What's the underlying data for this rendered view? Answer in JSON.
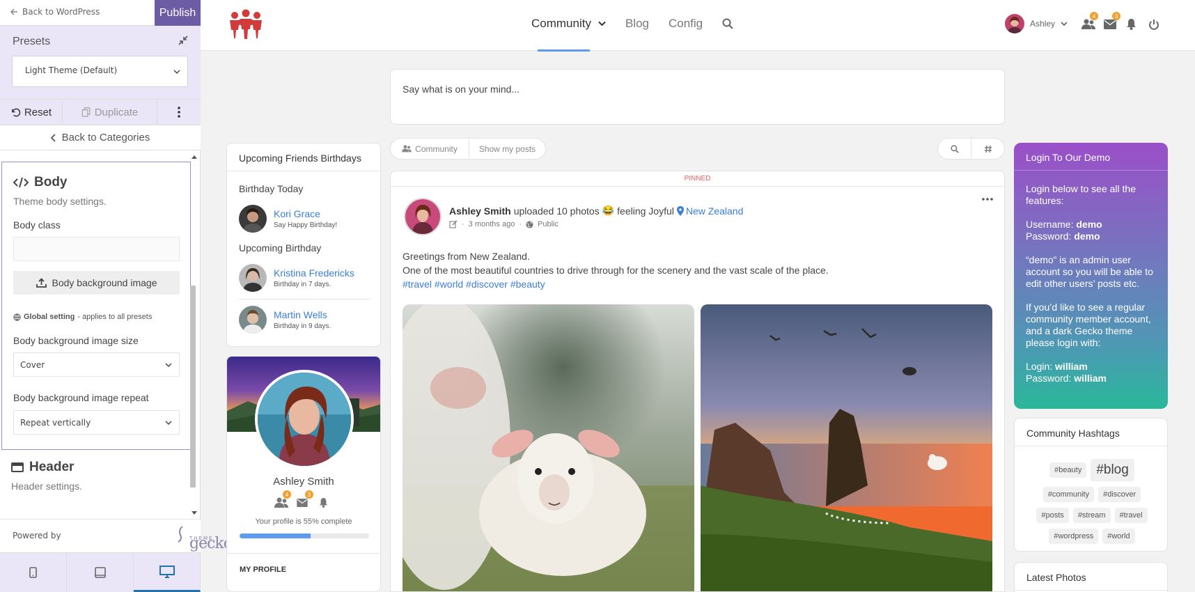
{
  "customizer": {
    "back_label": "Back to WordPress",
    "publish_label": "Publish",
    "presets_title": "Presets",
    "preset_selected": "Light Theme (Default)",
    "reset_label": "Reset",
    "duplicate_label": "Duplicate",
    "back_categories": "Back to Categories",
    "body": {
      "title": "Body",
      "desc": "Theme body settings.",
      "class_label": "Body class",
      "class_value": "",
      "bg_image_button": "Body background image",
      "global_bold": "Global setting",
      "global_rest": " - applies to all presets",
      "bg_size_label": "Body background image size",
      "bg_size_value": "Cover",
      "bg_repeat_label": "Body background image repeat",
      "bg_repeat_value": "Repeat vertically"
    },
    "header": {
      "title": "Header",
      "desc": "Header settings."
    },
    "powered_by": "Powered by",
    "logo_word": "gecko",
    "logo_sub": "THEME"
  },
  "nav": {
    "menu": [
      "Community",
      "Blog",
      "Config"
    ],
    "user_name": "Ashley",
    "friends_badge": "4",
    "messages_badge": "3"
  },
  "composer": {
    "placeholder": "Say what is on your mind..."
  },
  "stream_tabs": {
    "community": "Community",
    "my_posts": "Show my posts"
  },
  "birthdays": {
    "title": "Upcoming Friends Birthdays",
    "today_label": "Birthday Today",
    "upcoming_label": "Upcoming Birthday",
    "today": [
      {
        "name": "Kori Grace",
        "note": "Say Happy Birthday!"
      }
    ],
    "upcoming": [
      {
        "name": "Kristina Fredericks",
        "note": "Birthday in 7 days."
      },
      {
        "name": "Martin Wells",
        "note": "Birthday in 9 days."
      }
    ]
  },
  "profile": {
    "name": "Ashley Smith",
    "friends_badge": "4",
    "messages_badge": "3",
    "complete_text": "Your profile is 55% complete",
    "complete_fraction": 0.55,
    "my_profile": "MY PROFILE"
  },
  "post": {
    "pinned": "PINNED",
    "author": "Ashley Smith",
    "action": "uploaded 10 photos",
    "emoji": "😂",
    "feeling": "feeling Joyful",
    "location": "New Zealand",
    "time": "3 months ago",
    "privacy": "Public",
    "line1": "Greetings from New Zealand.",
    "line2": "One of the most beautiful countries to drive through for the scenery and the vast scale of the place.",
    "tags": "#travel #world #discover #beauty"
  },
  "login_demo": {
    "title": "Login To Our Demo",
    "intro": "Login below to see all the features:",
    "username_label": "Username: ",
    "username_value": "demo",
    "password_label": "Password: ",
    "password_value": "demo",
    "admin_note": "“demo” is an admin user account so you will be able to edit other users’ posts etc.",
    "regular_note": "If you’d like to see a regular community member account, and a dark Gecko theme please login with:",
    "login_label": "Login: ",
    "login_value": "william",
    "password2_label": "Password: ",
    "password2_value": "william"
  },
  "hashtags": {
    "title": "Community Hashtags",
    "tags": [
      "#beauty",
      "#blog",
      "#community",
      "#discover",
      "#posts",
      "#stream",
      "#travel",
      "#wordpress",
      "#world"
    ]
  },
  "latest_photos": {
    "title": "Latest Photos"
  }
}
